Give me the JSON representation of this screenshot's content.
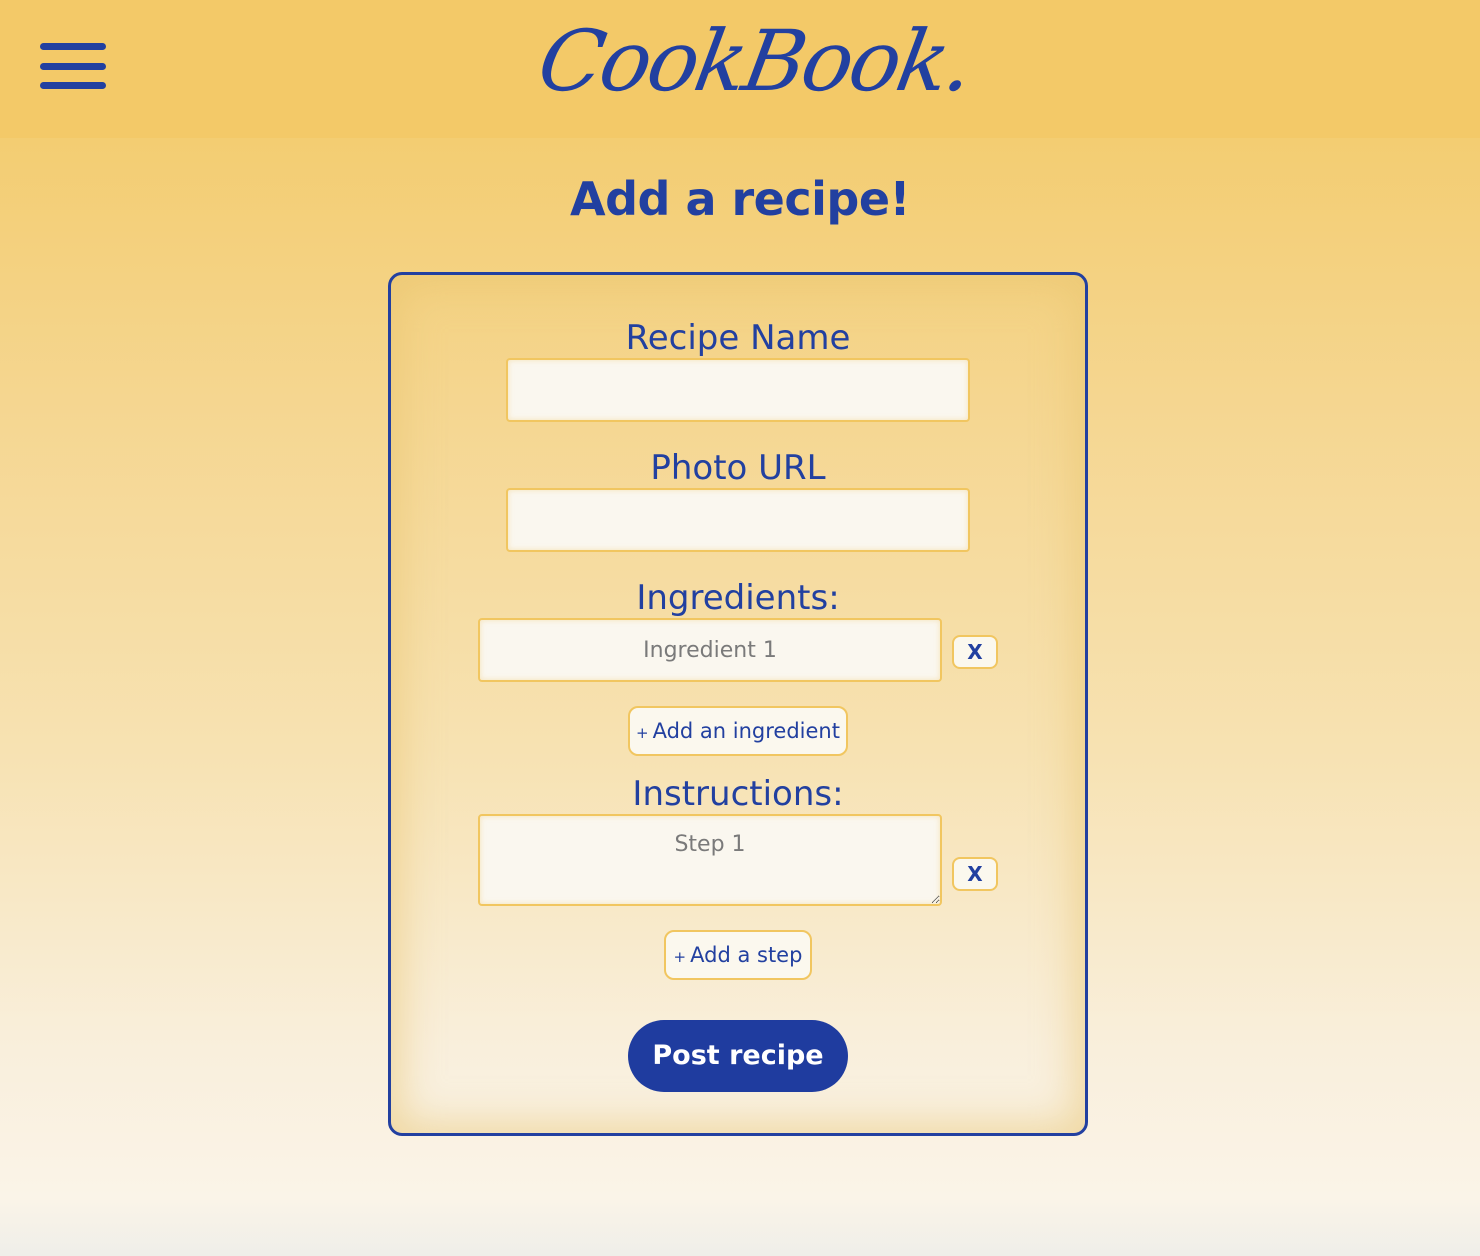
{
  "header": {
    "logo_text": "CookBook.",
    "menu_icon": "hamburger-menu-icon"
  },
  "page": {
    "title": "Add a recipe!"
  },
  "form": {
    "recipe_name_label": "Recipe Name",
    "recipe_name_value": "",
    "photo_url_label": "Photo URL",
    "photo_url_value": "",
    "ingredients_label": "Ingredients:",
    "ingredient_placeholder": "Ingredient 1",
    "remove_ingredient_label": "X",
    "add_ingredient_plus": "+",
    "add_ingredient_label": "Add an ingredient",
    "instructions_label": "Instructions:",
    "step_placeholder": "Step 1",
    "remove_step_label": "X",
    "add_step_plus": "+",
    "add_step_label": "Add a step",
    "submit_label": "Post recipe"
  },
  "colors": {
    "brand_blue": "#2240a0",
    "header_yellow": "#f3c968",
    "input_border": "#f1c660",
    "button_blue": "#1f3c9f"
  }
}
